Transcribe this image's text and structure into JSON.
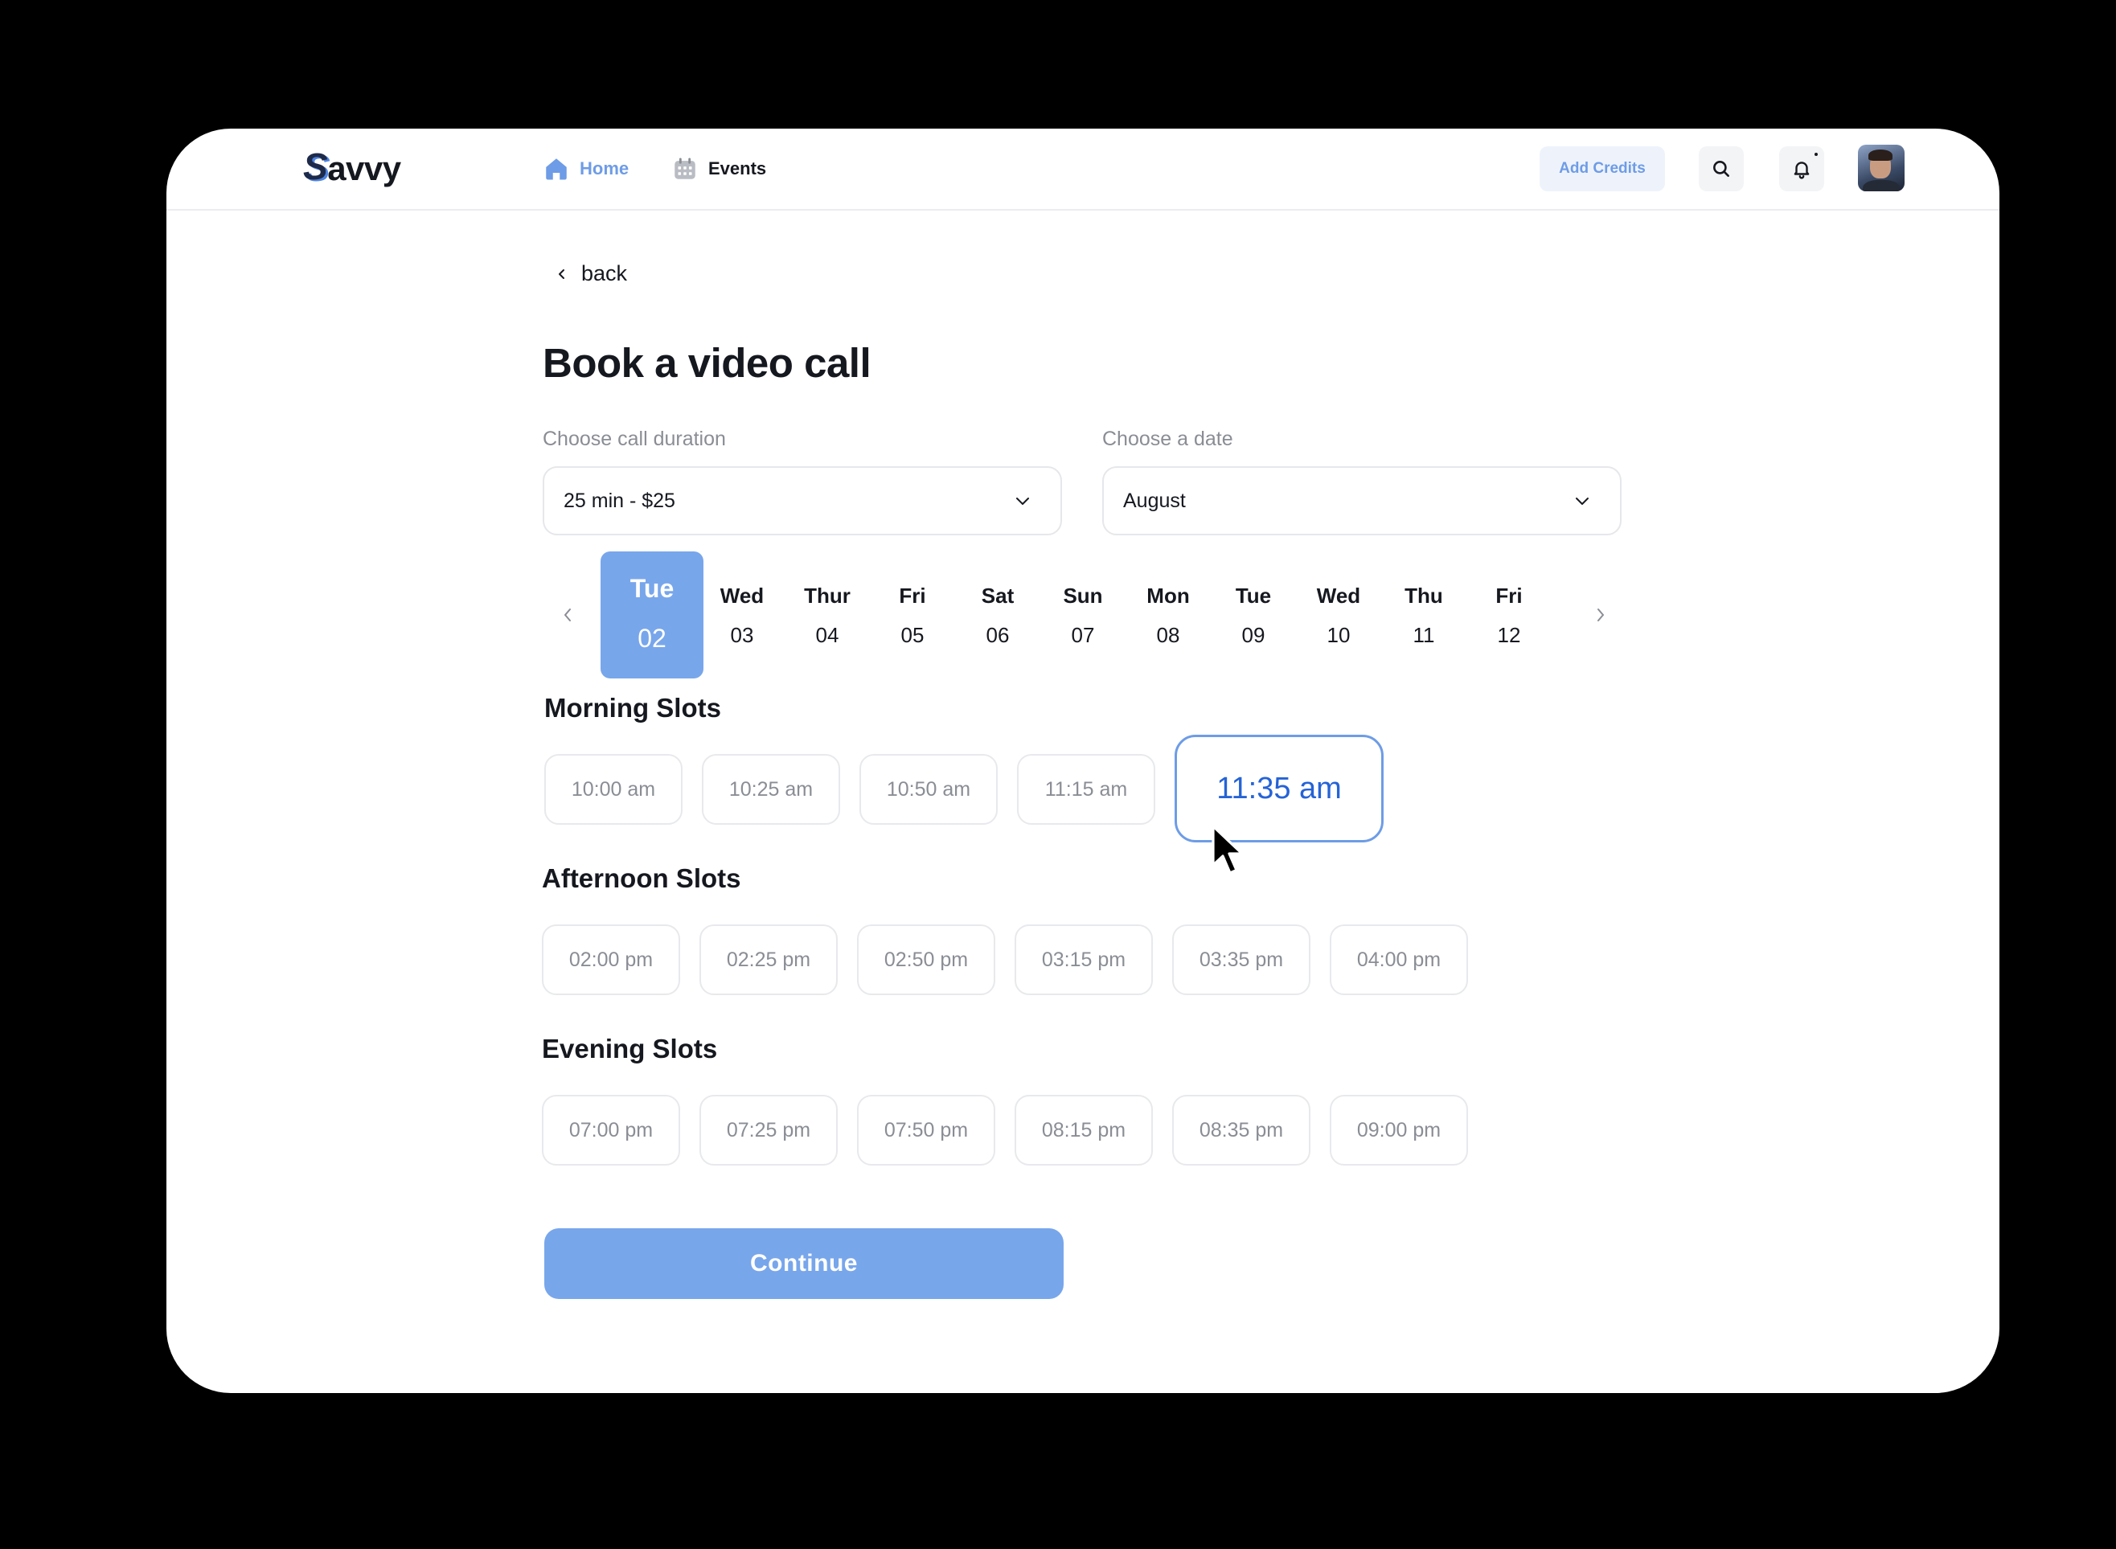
{
  "header": {
    "logo_text": "avvy",
    "logo_s": "S",
    "nav": [
      {
        "label": "Home",
        "icon": "home-icon"
      },
      {
        "label": "Events",
        "icon": "calendar-icon"
      }
    ],
    "add_credits_label": "Add Credits",
    "accent_color": "#6e9ce6"
  },
  "page": {
    "back_label": "back",
    "title": "Book a video call"
  },
  "duration": {
    "label": "Choose call duration",
    "value": "25 min - $25"
  },
  "date": {
    "label": "Choose a date",
    "value": "August"
  },
  "days": [
    {
      "name": "Tue",
      "date": "02",
      "selected": true
    },
    {
      "name": "Wed",
      "date": "03"
    },
    {
      "name": "Thur",
      "date": "04"
    },
    {
      "name": "Fri",
      "date": "05"
    },
    {
      "name": "Sat",
      "date": "06"
    },
    {
      "name": "Sun",
      "date": "07"
    },
    {
      "name": "Mon",
      "date": "08"
    },
    {
      "name": "Tue",
      "date": "09"
    },
    {
      "name": "Wed",
      "date": "10"
    },
    {
      "name": "Thu",
      "date": "11"
    },
    {
      "name": "Fri",
      "date": "12"
    }
  ],
  "sections": {
    "morning": {
      "title": "Morning Slots",
      "slots": [
        "10:00 am",
        "10:25 am",
        "10:50 am",
        "11:15 am",
        "11:35 am"
      ],
      "selected": "11:35 am"
    },
    "afternoon": {
      "title": "Afternoon Slots",
      "slots": [
        "02:00 pm",
        "02:25 pm",
        "02:50 pm",
        "03:15 pm",
        "03:35 pm",
        "04:00 pm"
      ]
    },
    "evening": {
      "title": "Evening Slots",
      "slots": [
        "07:00 pm",
        "07:25 pm",
        "07:50 pm",
        "08:15 pm",
        "08:35 pm",
        "09:00 pm"
      ]
    }
  },
  "continue_label": "Continue"
}
